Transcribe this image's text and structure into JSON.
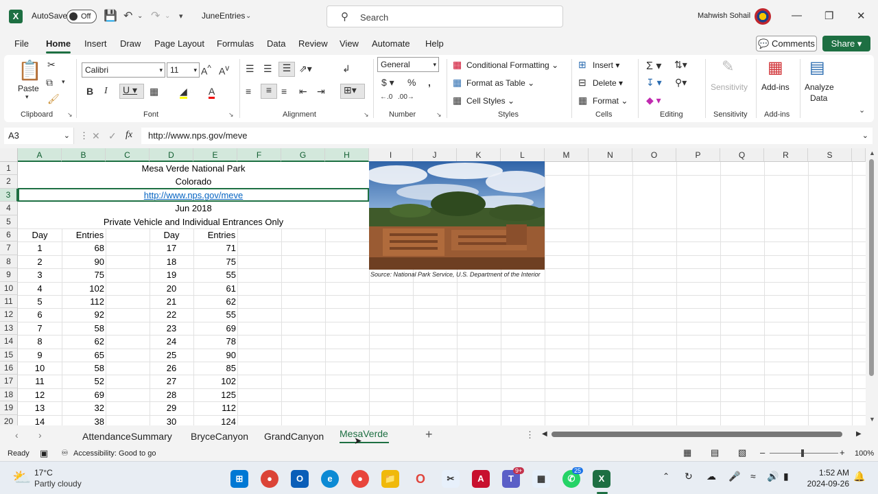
{
  "titlebar": {
    "autosave_label": "AutoSave",
    "autosave_state": "Off",
    "filename": "JuneEntries",
    "search_placeholder": "Search",
    "username": "Mahwish Sohail"
  },
  "menu": {
    "tabs": [
      "File",
      "Home",
      "Insert",
      "Draw",
      "Page Layout",
      "Formulas",
      "Data",
      "Review",
      "View",
      "Automate",
      "Help"
    ],
    "comments": "Comments",
    "share": "Share"
  },
  "ribbon": {
    "clipboard": {
      "paste": "Paste",
      "label": "Clipboard"
    },
    "font": {
      "name": "Calibri",
      "size": "11",
      "label": "Font"
    },
    "alignment": {
      "label": "Alignment"
    },
    "number": {
      "format": "General",
      "label": "Number"
    },
    "styles": {
      "conditional": "Conditional Formatting",
      "format_table": "Format as Table",
      "cell_styles": "Cell Styles",
      "label": "Styles"
    },
    "cells": {
      "insert": "Insert",
      "delete": "Delete",
      "format": "Format",
      "label": "Cells"
    },
    "editing": {
      "label": "Editing"
    },
    "sensitivity": {
      "button": "Sensitivity",
      "label": "Sensitivity"
    },
    "addins": {
      "button": "Add-ins",
      "label": "Add-ins"
    },
    "analyze": {
      "line1": "Analyze",
      "line2": "Data"
    }
  },
  "formula_bar": {
    "name_box": "A3",
    "formula": "http://www.nps.gov/meve"
  },
  "columns": [
    "A",
    "B",
    "C",
    "D",
    "E",
    "F",
    "G",
    "H",
    "I",
    "J",
    "K",
    "L",
    "M",
    "N",
    "O",
    "P",
    "Q",
    "R",
    "S"
  ],
  "rows": [
    "1",
    "2",
    "3",
    "4",
    "5",
    "6",
    "7",
    "8",
    "9",
    "10",
    "11",
    "12",
    "13",
    "14",
    "15",
    "16",
    "17",
    "18",
    "19",
    "20"
  ],
  "sheet": {
    "title": "Mesa Verde National Park",
    "state": "Colorado",
    "url": "http://www.nps.gov/meve",
    "month": "Jun 2018",
    "subtitle": "Private Vehicle and Individual Entrances Only",
    "headers": {
      "day1": "Day",
      "entries1": "Entries",
      "day2": "Day",
      "entries2": "Entries"
    },
    "data": [
      [
        "1",
        "68",
        "17",
        "71"
      ],
      [
        "2",
        "90",
        "18",
        "75"
      ],
      [
        "3",
        "75",
        "19",
        "55"
      ],
      [
        "4",
        "102",
        "20",
        "61"
      ],
      [
        "5",
        "112",
        "21",
        "62"
      ],
      [
        "6",
        "92",
        "22",
        "55"
      ],
      [
        "7",
        "58",
        "23",
        "69"
      ],
      [
        "8",
        "62",
        "24",
        "78"
      ],
      [
        "9",
        "65",
        "25",
        "90"
      ],
      [
        "10",
        "58",
        "26",
        "85"
      ],
      [
        "11",
        "52",
        "27",
        "102"
      ],
      [
        "12",
        "69",
        "28",
        "125"
      ],
      [
        "13",
        "32",
        "29",
        "112"
      ],
      [
        "14",
        "38",
        "30",
        "124"
      ]
    ],
    "image_caption": "Source: National Park Service, U.S. Department of the Interior"
  },
  "sheet_tabs": [
    "AttendanceSummary",
    "BryceCanyon",
    "GrandCanyon",
    "MesaVerde"
  ],
  "active_sheet": "MesaVerde",
  "status": {
    "ready": "Ready",
    "accessibility": "Accessibility: Good to go",
    "zoom": "100%"
  },
  "taskbar": {
    "temperature": "17°C",
    "weather": "Partly cloudy",
    "time": "1:52 AM",
    "date": "2024-09-26",
    "badge_teams": "9+",
    "badge_whatsapp": "25"
  }
}
